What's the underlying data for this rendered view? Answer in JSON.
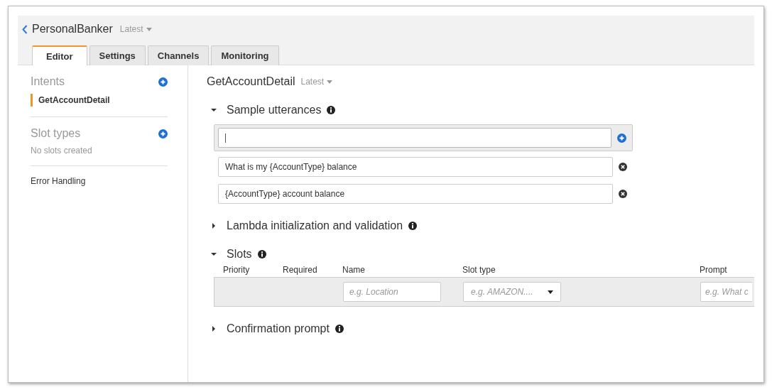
{
  "app": {
    "title": "PersonalBanker",
    "version": "Latest"
  },
  "tabs": [
    {
      "label": "Editor",
      "selected": true
    },
    {
      "label": "Settings",
      "selected": false
    },
    {
      "label": "Channels",
      "selected": false
    },
    {
      "label": "Monitoring",
      "selected": false
    }
  ],
  "sidebar": [
    {
      "kind": "group",
      "heading": "Intents",
      "items": [
        {
          "label": "GetAccountDetail",
          "selected": true
        }
      ]
    },
    {
      "kind": "group",
      "heading": "Slot types",
      "note": "No slots created"
    },
    {
      "kind": "link",
      "label": "Error Handling"
    }
  ],
  "intent": {
    "title": "GetAccountDetail",
    "version": "Latest"
  },
  "sections": [
    {
      "kind": "utterances",
      "title": "Sample utterances",
      "expanded": true,
      "new_utterance": {
        "focused": true
      },
      "utterances": [
        "What is my {AccountType} balance",
        "{AccountType} account balance"
      ]
    },
    {
      "kind": "plain",
      "title": "Lambda initialization and validation",
      "expanded": false
    },
    {
      "kind": "slots",
      "title": "Slots",
      "expanded": true,
      "columns": [
        "Priority",
        "Required",
        "Name",
        "Slot type",
        "Prompt"
      ],
      "new_slot": {
        "name_placeholder": "e.g. Location",
        "type_placeholder": "e.g. AMAZON....",
        "prompt_placeholder": "e.g. What c"
      }
    },
    {
      "kind": "plain",
      "title": "Confirmation prompt",
      "expanded": false
    }
  ]
}
